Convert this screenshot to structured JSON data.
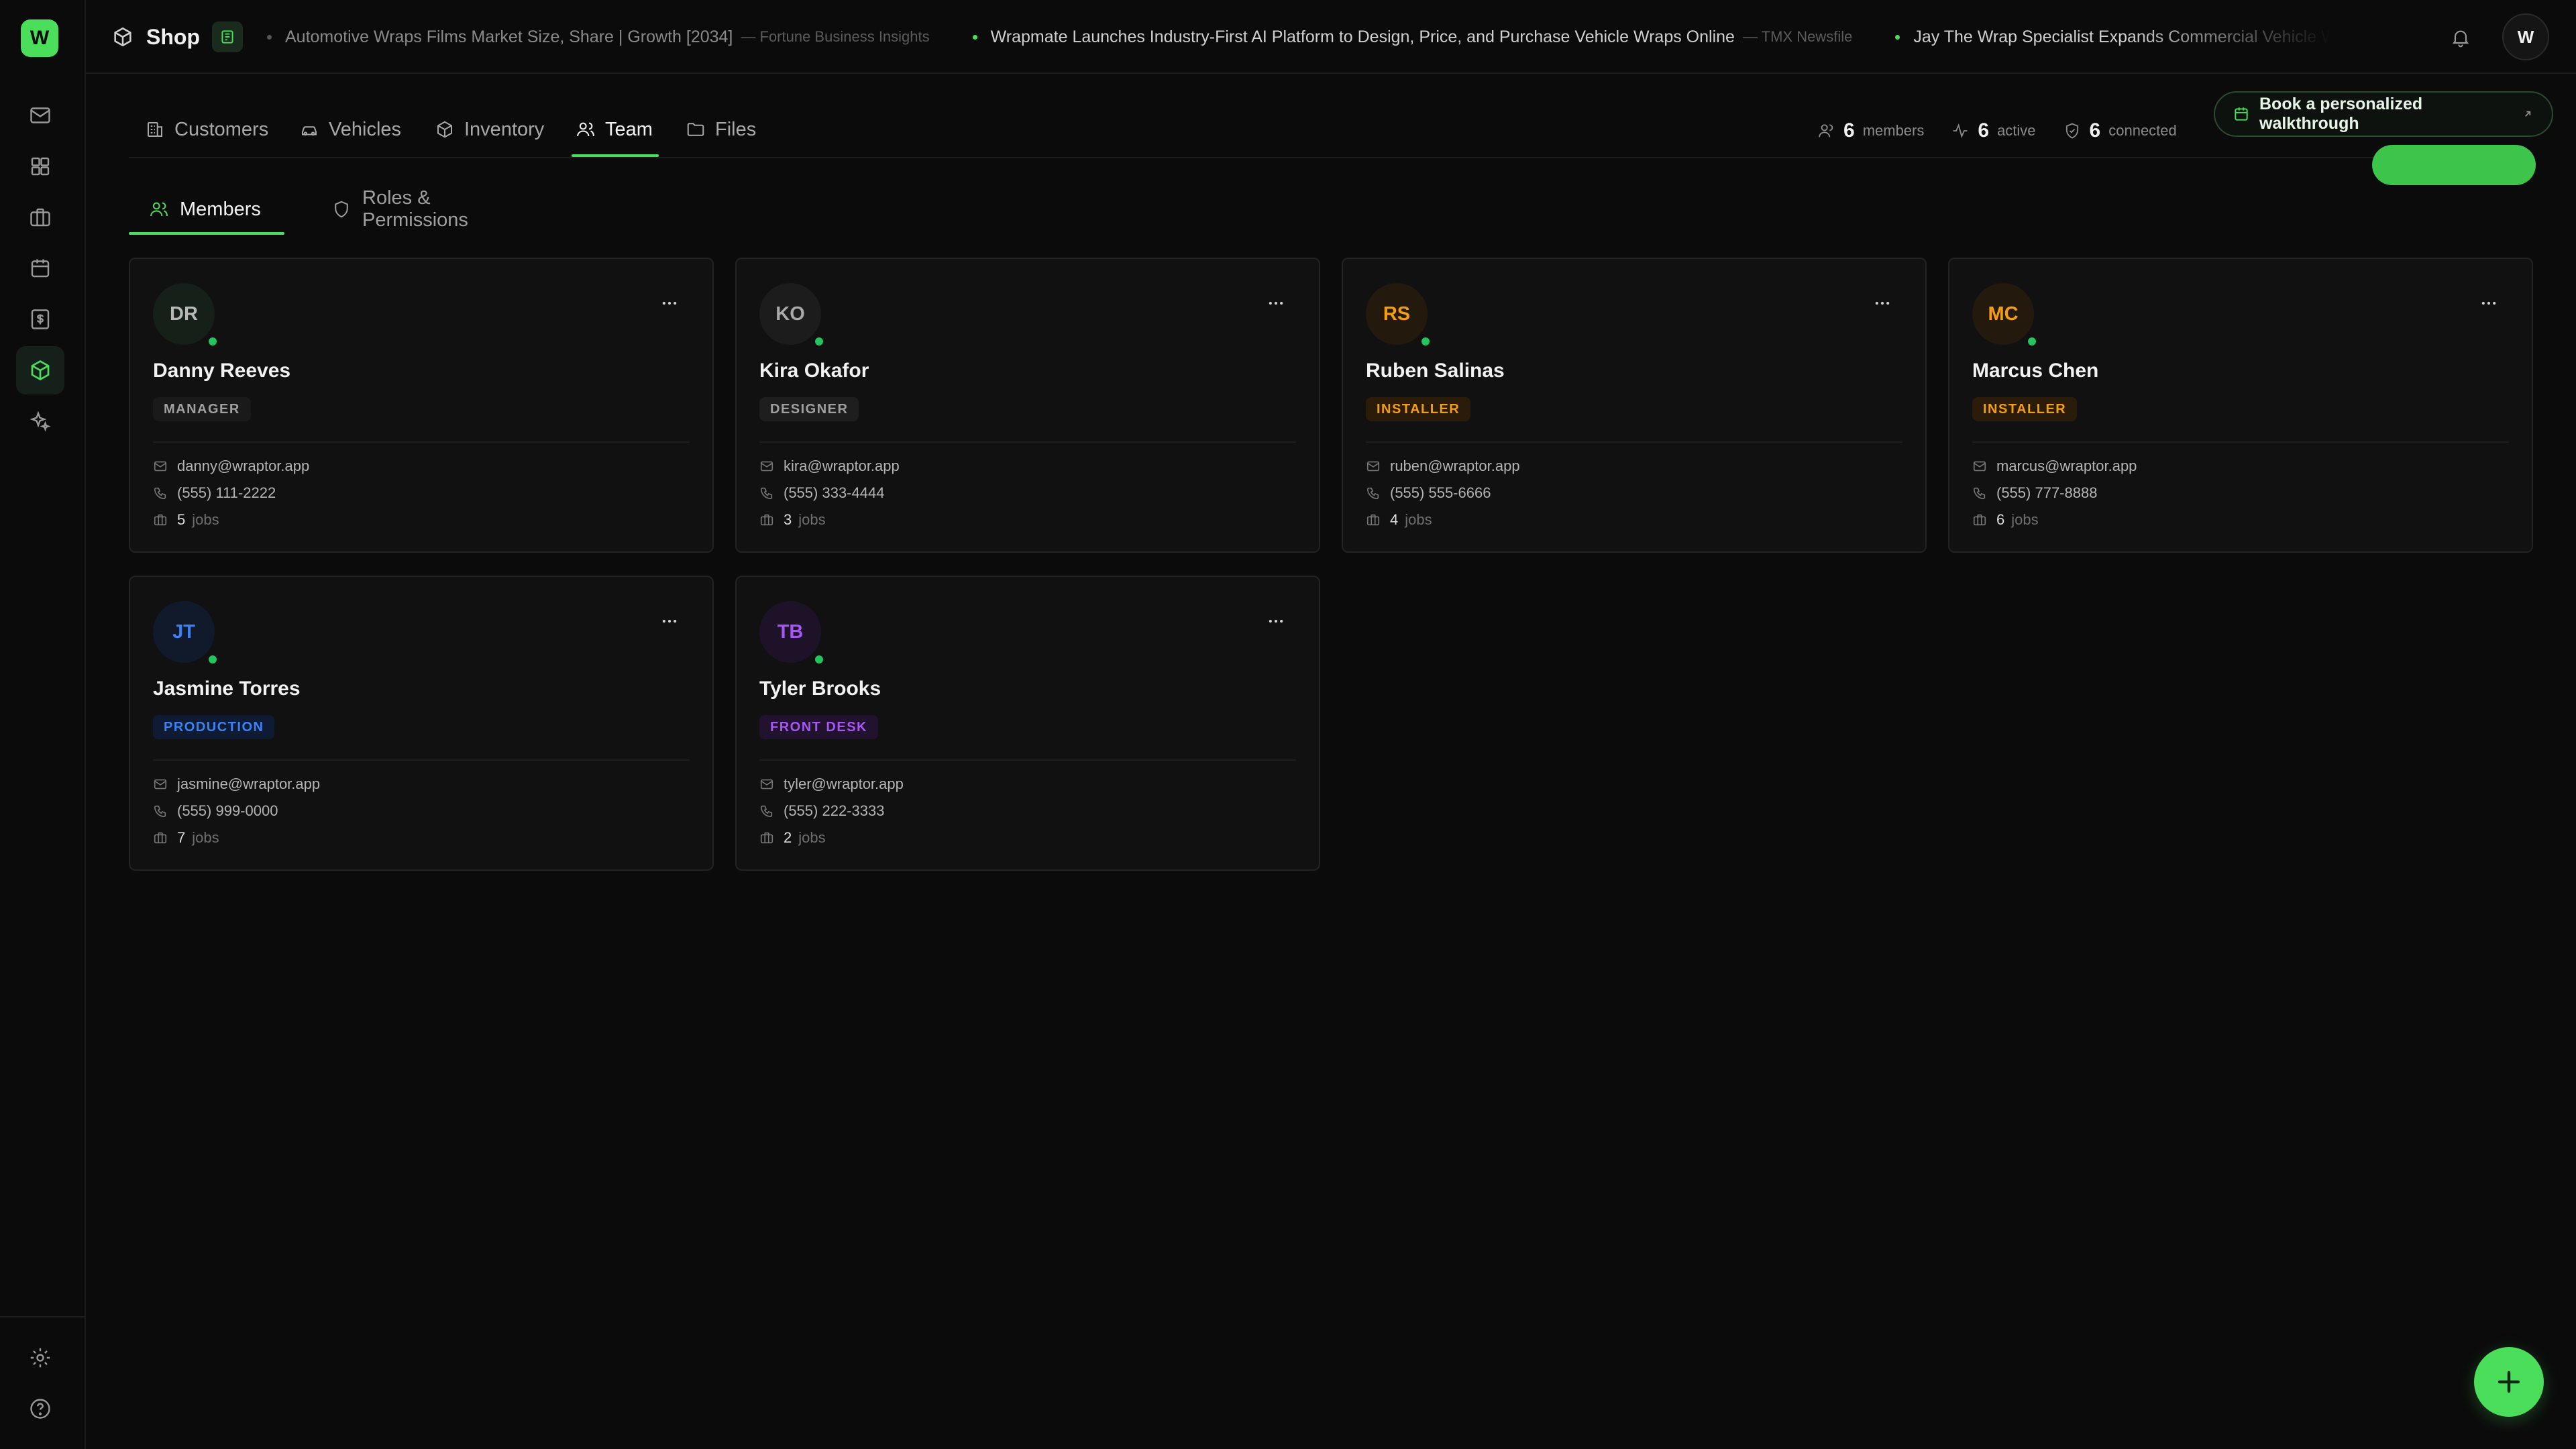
{
  "app": {
    "logo_letter": "W",
    "shop_title": "Shop",
    "user_initial": "W"
  },
  "ticker": [
    {
      "headline": "Automotive Wraps Films Market Size, Share | Growth [2034]",
      "source": "— Fortune Business Insights",
      "live": false
    },
    {
      "headline": "Wrapmate Launches Industry-First AI Platform to Design, Price, and Purchase Vehicle Wraps Online",
      "source": "— TMX Newsfile",
      "live": true
    },
    {
      "headline": "Jay The Wrap Specialist Expands Commercial Vehicle Wrap Services for Mobile",
      "source": "",
      "live": true
    }
  ],
  "sections": [
    {
      "label": "Customers",
      "icon": "building-icon"
    },
    {
      "label": "Vehicles",
      "icon": "car-icon"
    },
    {
      "label": "Inventory",
      "icon": "box-icon"
    },
    {
      "label": "Team",
      "icon": "users-icon"
    },
    {
      "label": "Files",
      "icon": "folder-icon"
    }
  ],
  "active_section": "Team",
  "stats": {
    "members": {
      "value": "6",
      "label": "members"
    },
    "active": {
      "value": "6",
      "label": "active"
    },
    "connected": {
      "value": "6",
      "label": "connected"
    }
  },
  "walkthrough_label": "Book a personalized walkthrough",
  "subtabs": {
    "members": "Members",
    "roles": "Roles & Permissions"
  },
  "jobs_label": "jobs",
  "members": [
    {
      "initials": "DR",
      "name": "Danny Reeves",
      "role": "MANAGER",
      "email": "danny@wraptor.app",
      "phone": "(555) 111-2222",
      "jobs": "5"
    },
    {
      "initials": "KO",
      "name": "Kira Okafor",
      "role": "DESIGNER",
      "email": "kira@wraptor.app",
      "phone": "(555) 333-4444",
      "jobs": "3"
    },
    {
      "initials": "RS",
      "name": "Ruben Salinas",
      "role": "INSTALLER",
      "email": "ruben@wraptor.app",
      "phone": "(555) 555-6666",
      "jobs": "4"
    },
    {
      "initials": "MC",
      "name": "Marcus Chen",
      "role": "INSTALLER",
      "email": "marcus@wraptor.app",
      "phone": "(555) 777-8888",
      "jobs": "6"
    },
    {
      "initials": "JT",
      "name": "Jasmine Torres",
      "role": "PRODUCTION",
      "email": "jasmine@wraptor.app",
      "phone": "(555) 999-0000",
      "jobs": "7"
    },
    {
      "initials": "TB",
      "name": "Tyler Brooks",
      "role": "FRONT DESK",
      "email": "tyler@wraptor.app",
      "phone": "(555) 222-3333",
      "jobs": "2"
    }
  ],
  "colors": {
    "accent": "#4ade5a",
    "online": "#22c55e",
    "role_manager": "#a0a0a0",
    "role_designer": "#a0a0a0",
    "role_installer": "#f59e0b",
    "role_production": "#3b82f6",
    "role_front_desk": "#a855f7"
  }
}
